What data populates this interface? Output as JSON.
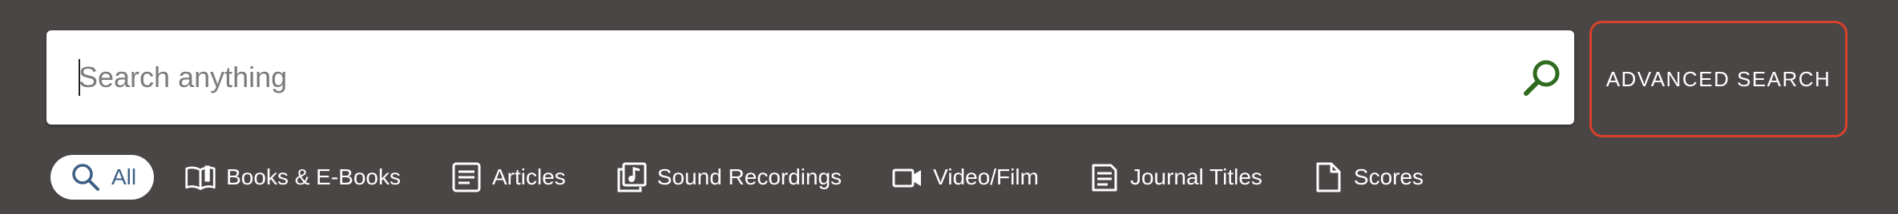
{
  "search": {
    "placeholder": "Search anything",
    "value": ""
  },
  "advanced_search": {
    "label": "ADVANCED SEARCH"
  },
  "filters": [
    {
      "label": "All",
      "icon": "search-icon",
      "active": true
    },
    {
      "label": "Books & E-Books",
      "icon": "book-icon",
      "active": false
    },
    {
      "label": "Articles",
      "icon": "article-icon",
      "active": false
    },
    {
      "label": "Sound Recordings",
      "icon": "music-note-icon",
      "active": false
    },
    {
      "label": "Video/Film",
      "icon": "video-camera-icon",
      "active": false
    },
    {
      "label": "Journal Titles",
      "icon": "journal-icon",
      "active": false
    },
    {
      "label": "Scores",
      "icon": "document-icon",
      "active": false
    }
  ],
  "colors": {
    "background": "#4a4645",
    "search_icon": "#2e6b1f",
    "advanced_border": "#d9412b",
    "active_filter_text": "#3d5f84"
  }
}
